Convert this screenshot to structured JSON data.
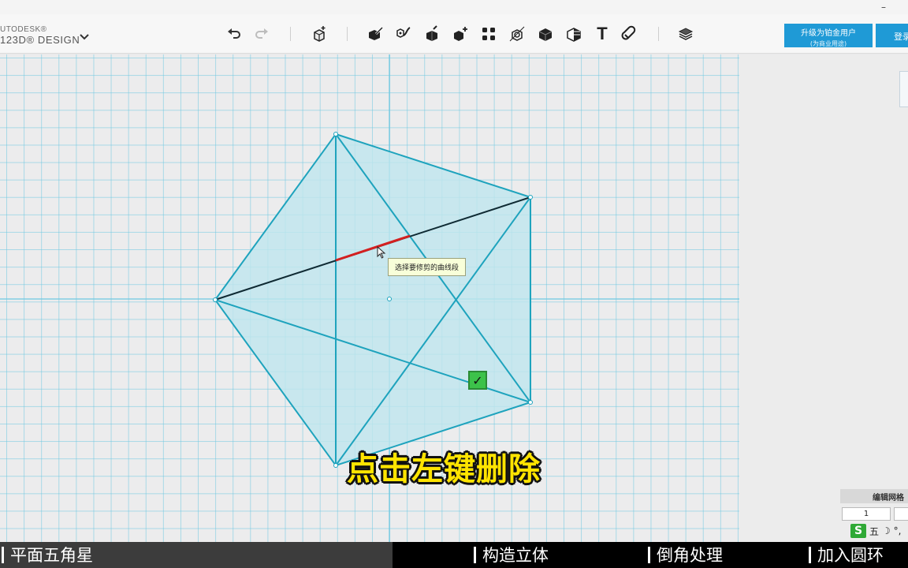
{
  "app": {
    "logo_top": "UTODESK®",
    "logo_bottom": "123D® DESIGN",
    "window_minimize": "–"
  },
  "toolbar": {
    "tools": [
      {
        "name": "undo-icon",
        "icon": "undo"
      },
      {
        "name": "redo-icon",
        "icon": "redo"
      },
      {
        "name": "primitives-icon",
        "icon": "box-plus"
      },
      {
        "name": "sketch-icon",
        "icon": "sketch"
      },
      {
        "name": "construct-icon",
        "icon": "construct"
      },
      {
        "name": "modify-icon",
        "icon": "modify"
      },
      {
        "name": "pattern-icon",
        "icon": "pattern"
      },
      {
        "name": "group-icon",
        "icon": "group"
      },
      {
        "name": "combine-icon",
        "icon": "combine"
      },
      {
        "name": "measure-icon",
        "icon": "measure"
      },
      {
        "name": "text-icon",
        "icon": "text"
      },
      {
        "name": "snap-icon",
        "icon": "snap"
      },
      {
        "name": "material-icon",
        "icon": "material"
      }
    ],
    "text_tool_glyph": "T",
    "upgrade_label": "升级为铂金用户",
    "upgrade_sublabel": "(为商业用途)",
    "login_label": "登录"
  },
  "canvas": {
    "tooltip": "选择要修剪的曲线段",
    "confirm_glyph": "✓",
    "colors": {
      "grid": "#6ec8e1",
      "shape_fill": "#bfe6ee",
      "shape_stroke": "#1ea3bd",
      "highlight_line": "#0f2a33",
      "trim_segment": "#d42020"
    }
  },
  "caption": "点击左键删除",
  "grid_panel": {
    "title": "编辑网格",
    "value": "1"
  },
  "ime": {
    "logo": "S",
    "mode": "五",
    "extra": "☽ °,"
  },
  "chapters": [
    {
      "label": "平面五角星",
      "active": true
    },
    {
      "label": "构造立体",
      "active": false
    },
    {
      "label": "倒角处理",
      "active": false
    },
    {
      "label": "加入圆环",
      "active": false
    }
  ]
}
